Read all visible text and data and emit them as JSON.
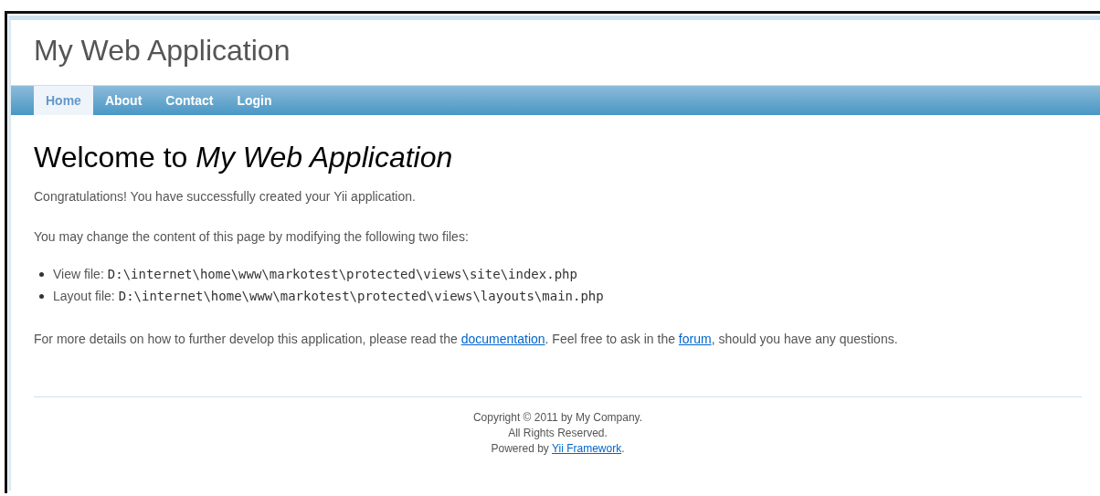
{
  "header": {
    "title": "My Web Application"
  },
  "nav": [
    {
      "label": "Home",
      "selected": true
    },
    {
      "label": "About",
      "selected": false
    },
    {
      "label": "Contact",
      "selected": false
    },
    {
      "label": "Login",
      "selected": false
    }
  ],
  "content": {
    "heading": "Welcome to *My Web Application*",
    "intro": "Congratulations! You have successfully created your Yii application.",
    "files_note": "You may change the content of this page by modifying the following two files:",
    "files": [
      {
        "label": "View file:",
        "path": "D:\\internet\\home\\www\\markotest\\protected\\views\\site\\index.php"
      },
      {
        "label": "Layout file:",
        "path": "D:\\internet\\home\\www\\markotest\\protected\\views\\layouts\\main.php"
      }
    ],
    "details": [
      {
        "text": "For more details on how to further develop this application, please read the ",
        "link": false
      },
      {
        "text": "documentation",
        "link": true
      },
      {
        "text": ". Feel free to ask in the ",
        "link": false
      },
      {
        "text": "forum",
        "link": true
      },
      {
        "text": ", should you have any questions.",
        "link": false
      }
    ]
  },
  "footer": [
    [
      {
        "text": "Copyright © 2011 by My Company.",
        "link": false
      }
    ],
    [
      {
        "text": "All Rights Reserved.",
        "link": false
      }
    ],
    [
      {
        "text": "Powered by ",
        "link": false
      },
      {
        "text": "Yii Framework",
        "link": true
      },
      {
        "text": ".",
        "link": false
      }
    ]
  ]
}
